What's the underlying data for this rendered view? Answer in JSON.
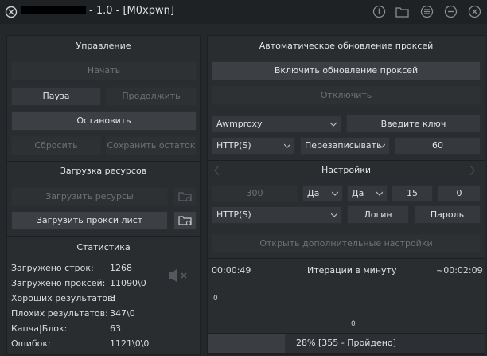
{
  "window": {
    "title_suffix": "- 1.0 - [M0xpwn]",
    "icons": [
      "app-logo-icon",
      "info-icon",
      "folder-icon",
      "menu-icon",
      "minimize-icon",
      "close-icon"
    ]
  },
  "control": {
    "title": "Управление",
    "start": "Начать",
    "pause": "Пауза",
    "resume": "Продолжить",
    "stop": "Остановить",
    "reset": "Сбросить",
    "save_rest": "Сохранить остаток"
  },
  "resources": {
    "title": "Загрузка ресурсов",
    "load_resources": "Загрузить ресурсы",
    "load_proxy": "Загрузить прокси лист"
  },
  "stats": {
    "title": "Статистика",
    "rows": [
      {
        "label": "Загружено строк:",
        "value": "1268"
      },
      {
        "label": "Загружено проксей:",
        "value": "11090\\0"
      },
      {
        "label": "Хороших результатов:",
        "value": "8"
      },
      {
        "label": "Плохих результатов:",
        "value": "347\\0"
      },
      {
        "label": "Капча|Блок:",
        "value": "63"
      },
      {
        "label": "Ошибок:",
        "value": "1121\\0\\0"
      }
    ]
  },
  "proxy_update": {
    "title": "Автоматическое обновление проксей",
    "enable": "Включить обновление проксей",
    "disable": "Отключить",
    "source": "Awmproxy",
    "key_placeholder": "Введите ключ",
    "type": "HTTP(S)",
    "mode": "Перезаписывать",
    "interval": "60"
  },
  "settings": {
    "title": "Настройки",
    "threads": "300",
    "opt1": "Да",
    "opt2": "Да",
    "num1": "15",
    "num2": "0",
    "proxy_type": "HTTP(S)",
    "login": "Логин",
    "password": "Пароль",
    "advanced": "Открыть дополнительные настройки"
  },
  "timer": {
    "elapsed": "00:00:49",
    "label": "Итерации в минуту",
    "remaining": "~00:02:09",
    "y_value": "0",
    "x_value": "0"
  },
  "progress": {
    "text": "28% [355 - Пройдено]",
    "fraction": 0.28
  }
}
